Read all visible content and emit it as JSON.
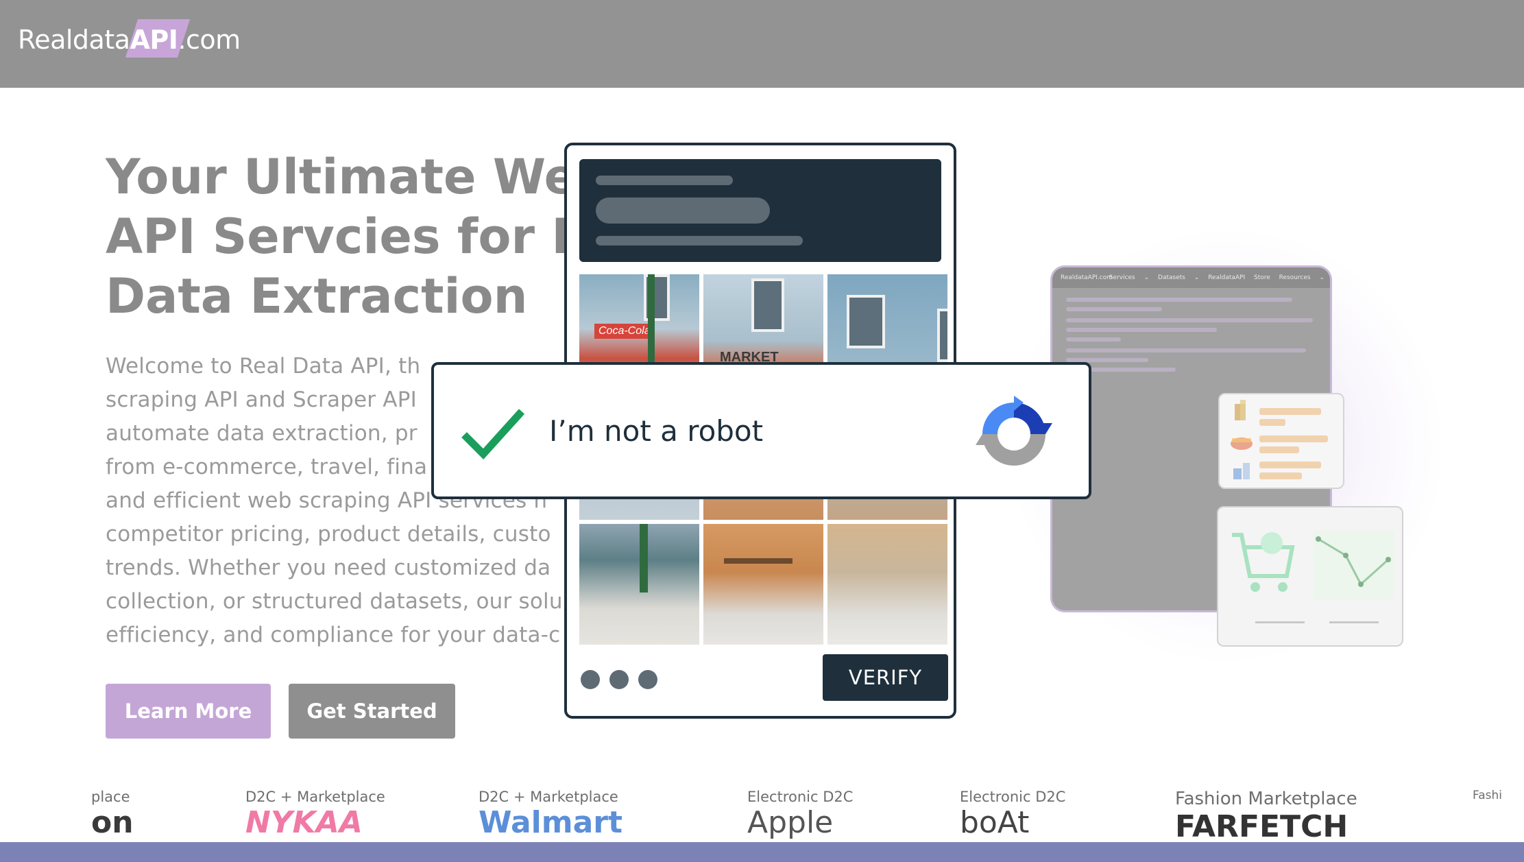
{
  "header": {
    "logo_prefix": "Realdata",
    "logo_api": "API",
    "logo_suffix": ".com"
  },
  "hero": {
    "title_lines": [
      "Your Ultimate We",
      "API Servcies for R",
      "Data Extraction"
    ],
    "desc_lines": [
      "Welcome to Real Data API, th",
      "scraping API and Scraper API",
      "automate data extraction, pr",
      "from e-commerce, travel, fina",
      "and efficient web scraping API services h",
      "competitor pricing, product details, custo",
      "trends. Whether you need customized da",
      "collection, or structured datasets, our solu",
      "efficiency, and compliance for your data-c"
    ],
    "learn_more": "Learn More",
    "get_started": "Get Started"
  },
  "captcha": {
    "robot_label": "I’m not a robot",
    "verify_label": "VERIFY",
    "tile_sign_1": "Coca-Cola",
    "tile_sign_2": "MARKET"
  },
  "mock_browser": {
    "logo": "RealdataAPI.com",
    "nav": "Services ⌄ Datasets ⌄ RealdataAPI Store Resources ⌄"
  },
  "logos": [
    {
      "category": "place",
      "brand": "on",
      "color": "#3a3a3a"
    },
    {
      "category": "D2C + Marketplace",
      "brand": "NYKAA",
      "color": "#f07aa6"
    },
    {
      "category": "D2C + Marketplace",
      "brand": "Walmart",
      "color": "#5c8fd8"
    },
    {
      "category": "Electronic D2C",
      "brand": "Apple",
      "color": "#555555"
    },
    {
      "category": "Electronic D2C",
      "brand": "boAt",
      "color": "#444444"
    },
    {
      "category": "Fashion Marketplace",
      "brand": "FARFETCH",
      "color": "#333333"
    },
    {
      "category": "Fashi",
      "brand": "",
      "color": "#e06bb0"
    }
  ],
  "colors": {
    "topbar": "#939393",
    "accent_purple": "#c4a6d6",
    "captcha_dark": "#1f2f3c",
    "check_green": "#1a9e5c",
    "recaptcha_blue": "#1c58e3",
    "bottom_strip": "#7d82b6"
  }
}
